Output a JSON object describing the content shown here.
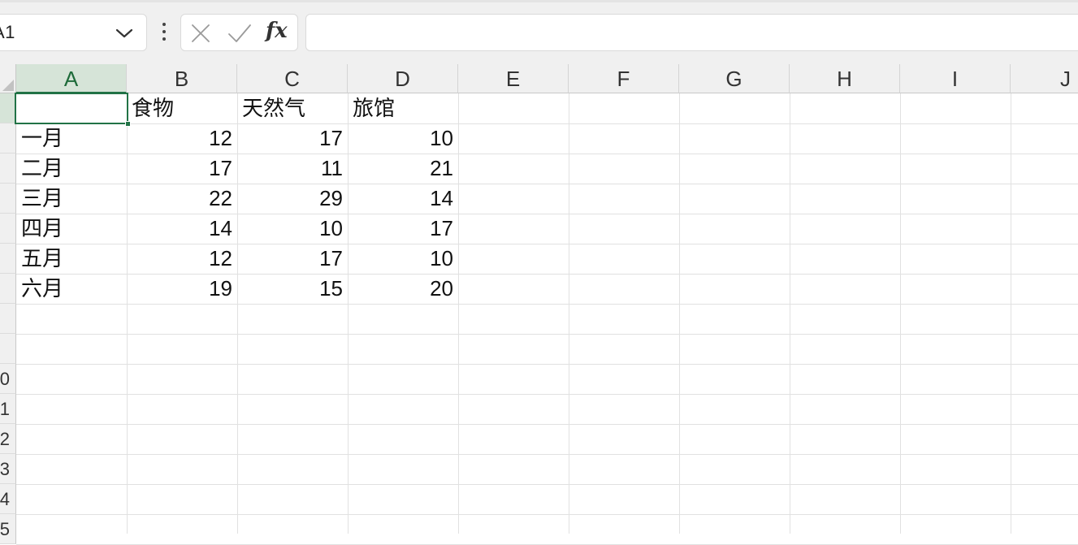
{
  "name_box": {
    "value": "A1",
    "display": "\u00041"
  },
  "formula_bar": {
    "fx_label": "fx",
    "content": ""
  },
  "columns": [
    "A",
    "B",
    "C",
    "D",
    "E",
    "F",
    "G",
    "H",
    "I",
    "J"
  ],
  "rows": [
    "",
    "",
    "",
    "",
    "",
    "",
    "",
    "",
    "",
    "0",
    "1",
    "2",
    "3",
    "4",
    "5"
  ],
  "sheet": {
    "header": [
      "",
      "食物",
      "天然气",
      "旅馆"
    ],
    "data": [
      {
        "label": "一月",
        "values": [
          "12",
          "17",
          "10"
        ]
      },
      {
        "label": "二月",
        "values": [
          "17",
          "11",
          "21"
        ]
      },
      {
        "label": "三月",
        "values": [
          "22",
          "29",
          "14"
        ]
      },
      {
        "label": "四月",
        "values": [
          "14",
          "10",
          "17"
        ]
      },
      {
        "label": "五月",
        "values": [
          "12",
          "17",
          "10"
        ]
      },
      {
        "label": "六月",
        "values": [
          "19",
          "15",
          "20"
        ]
      }
    ]
  },
  "selected_cell": "A1",
  "colors": {
    "accent": "#217346",
    "header_bg": "#f0f0f0",
    "gridline": "#e1e1e1"
  }
}
